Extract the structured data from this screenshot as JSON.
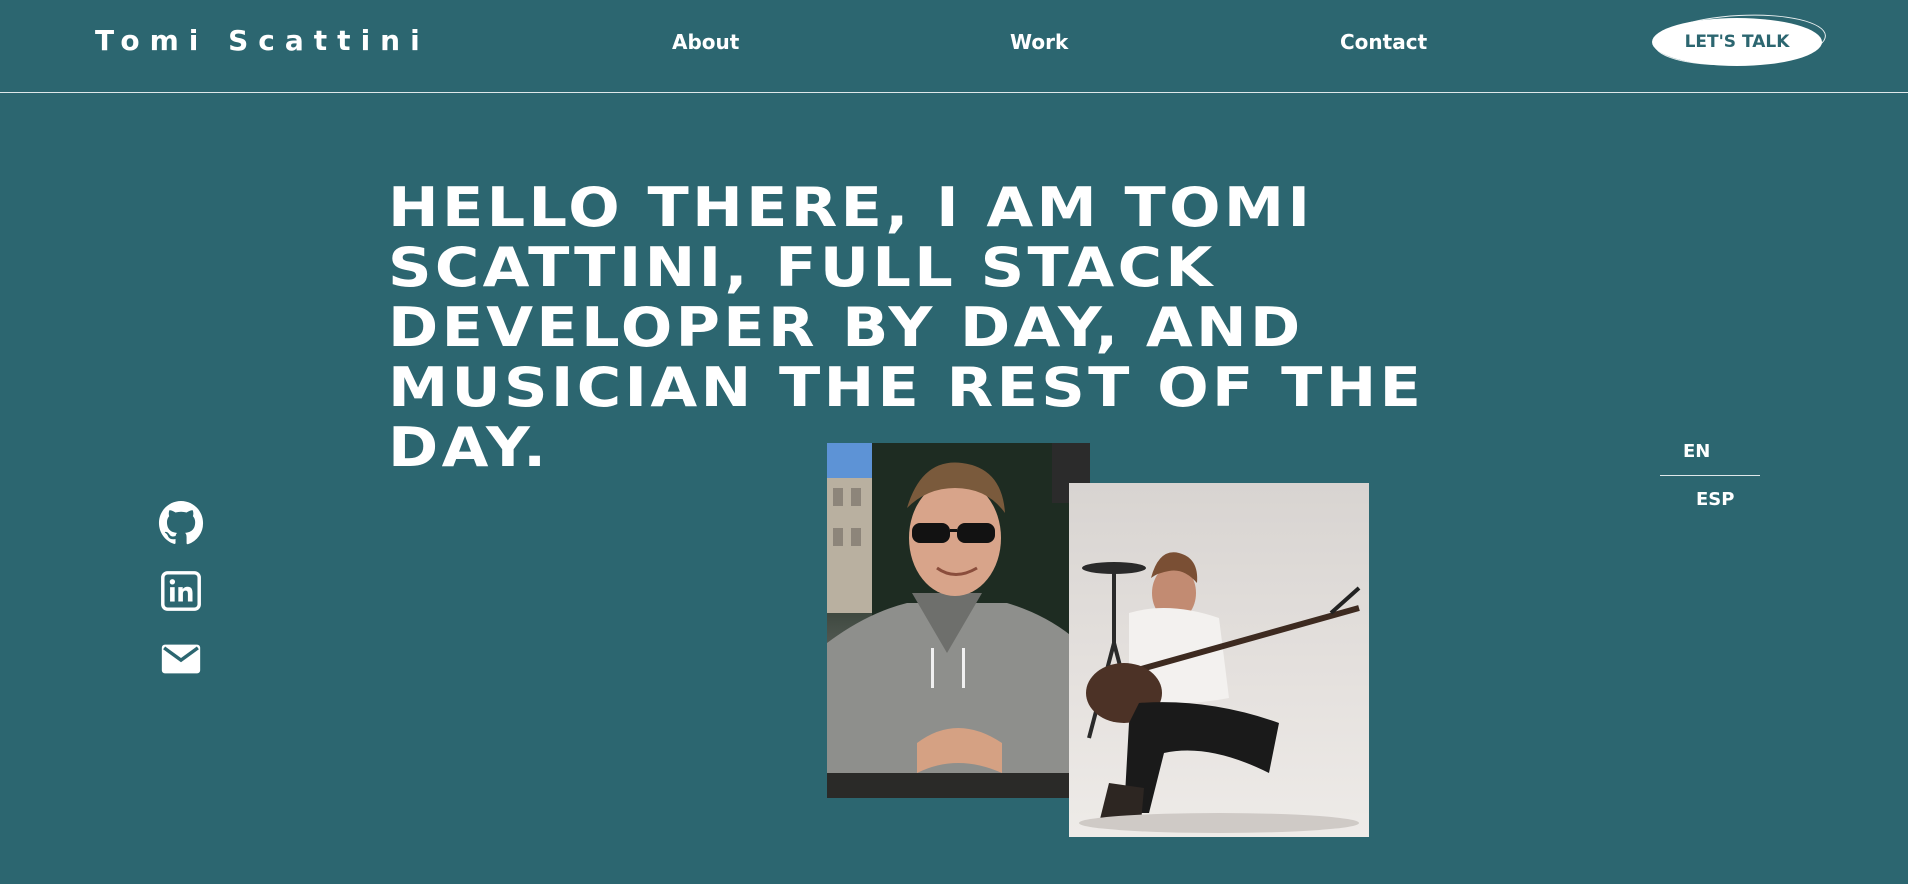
{
  "header": {
    "brand": "Tomi Scattini",
    "nav": [
      {
        "label": "About"
      },
      {
        "label": "Work"
      },
      {
        "label": "Contact"
      }
    ],
    "cta_label": "LET'S TALK"
  },
  "hero": {
    "headline": "HELLO THERE, I AM TOMI SCATTINI, FULL STACK DEVELOPER BY DAY, AND MUSICIAN THE REST OF THE DAY."
  },
  "social": [
    {
      "icon": "github-icon"
    },
    {
      "icon": "linkedin-icon"
    },
    {
      "icon": "email-icon"
    }
  ],
  "language": {
    "options": [
      {
        "label": "EN"
      },
      {
        "label": "ESP"
      }
    ]
  },
  "photos": [
    {
      "subject": "portrait"
    },
    {
      "subject": "bass-player"
    }
  ],
  "colors": {
    "background": "#2c6670",
    "text": "#ffffff",
    "cta_text": "#2c6670"
  }
}
